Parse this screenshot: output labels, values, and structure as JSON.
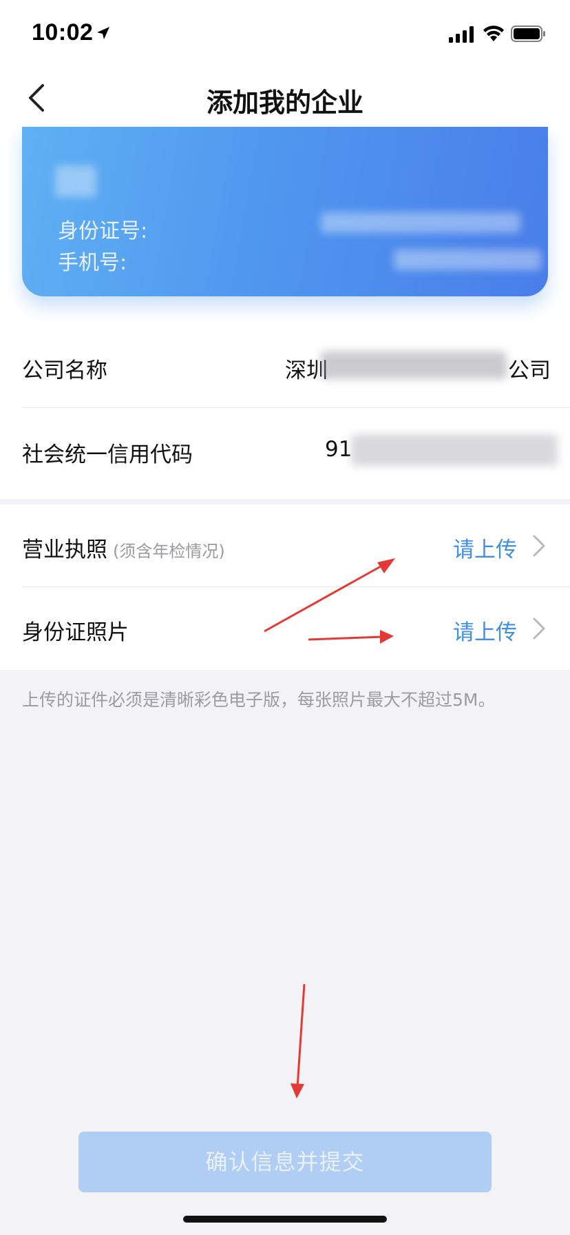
{
  "status_bar": {
    "time": "10:02"
  },
  "nav": {
    "title": "添加我的企业"
  },
  "profile_card": {
    "id_label": "身份证号:",
    "phone_label": "手机号:"
  },
  "company_info": {
    "name_label": "公司名称",
    "name_value_start": "深圳",
    "name_value_end": "公司",
    "credit_code_label": "社会统一信用代码",
    "credit_code_value_start": "91"
  },
  "uploads": [
    {
      "label": "营业执照",
      "note": "(须含年检情况)",
      "action": "请上传"
    },
    {
      "label": "身份证照片",
      "note": "",
      "action": "请上传"
    }
  ],
  "hint": "上传的证件必须是清晰彩色电子版，每张照片最大不超过5M。",
  "submit": {
    "label": "确认信息并提交"
  },
  "colors": {
    "accent": "#3f8ee8",
    "card_gradient_start": "#5fb0f3",
    "card_gradient_end": "#4a7ee9",
    "submit_disabled": "#b0cdf3",
    "annotation_arrow": "#e53935"
  }
}
